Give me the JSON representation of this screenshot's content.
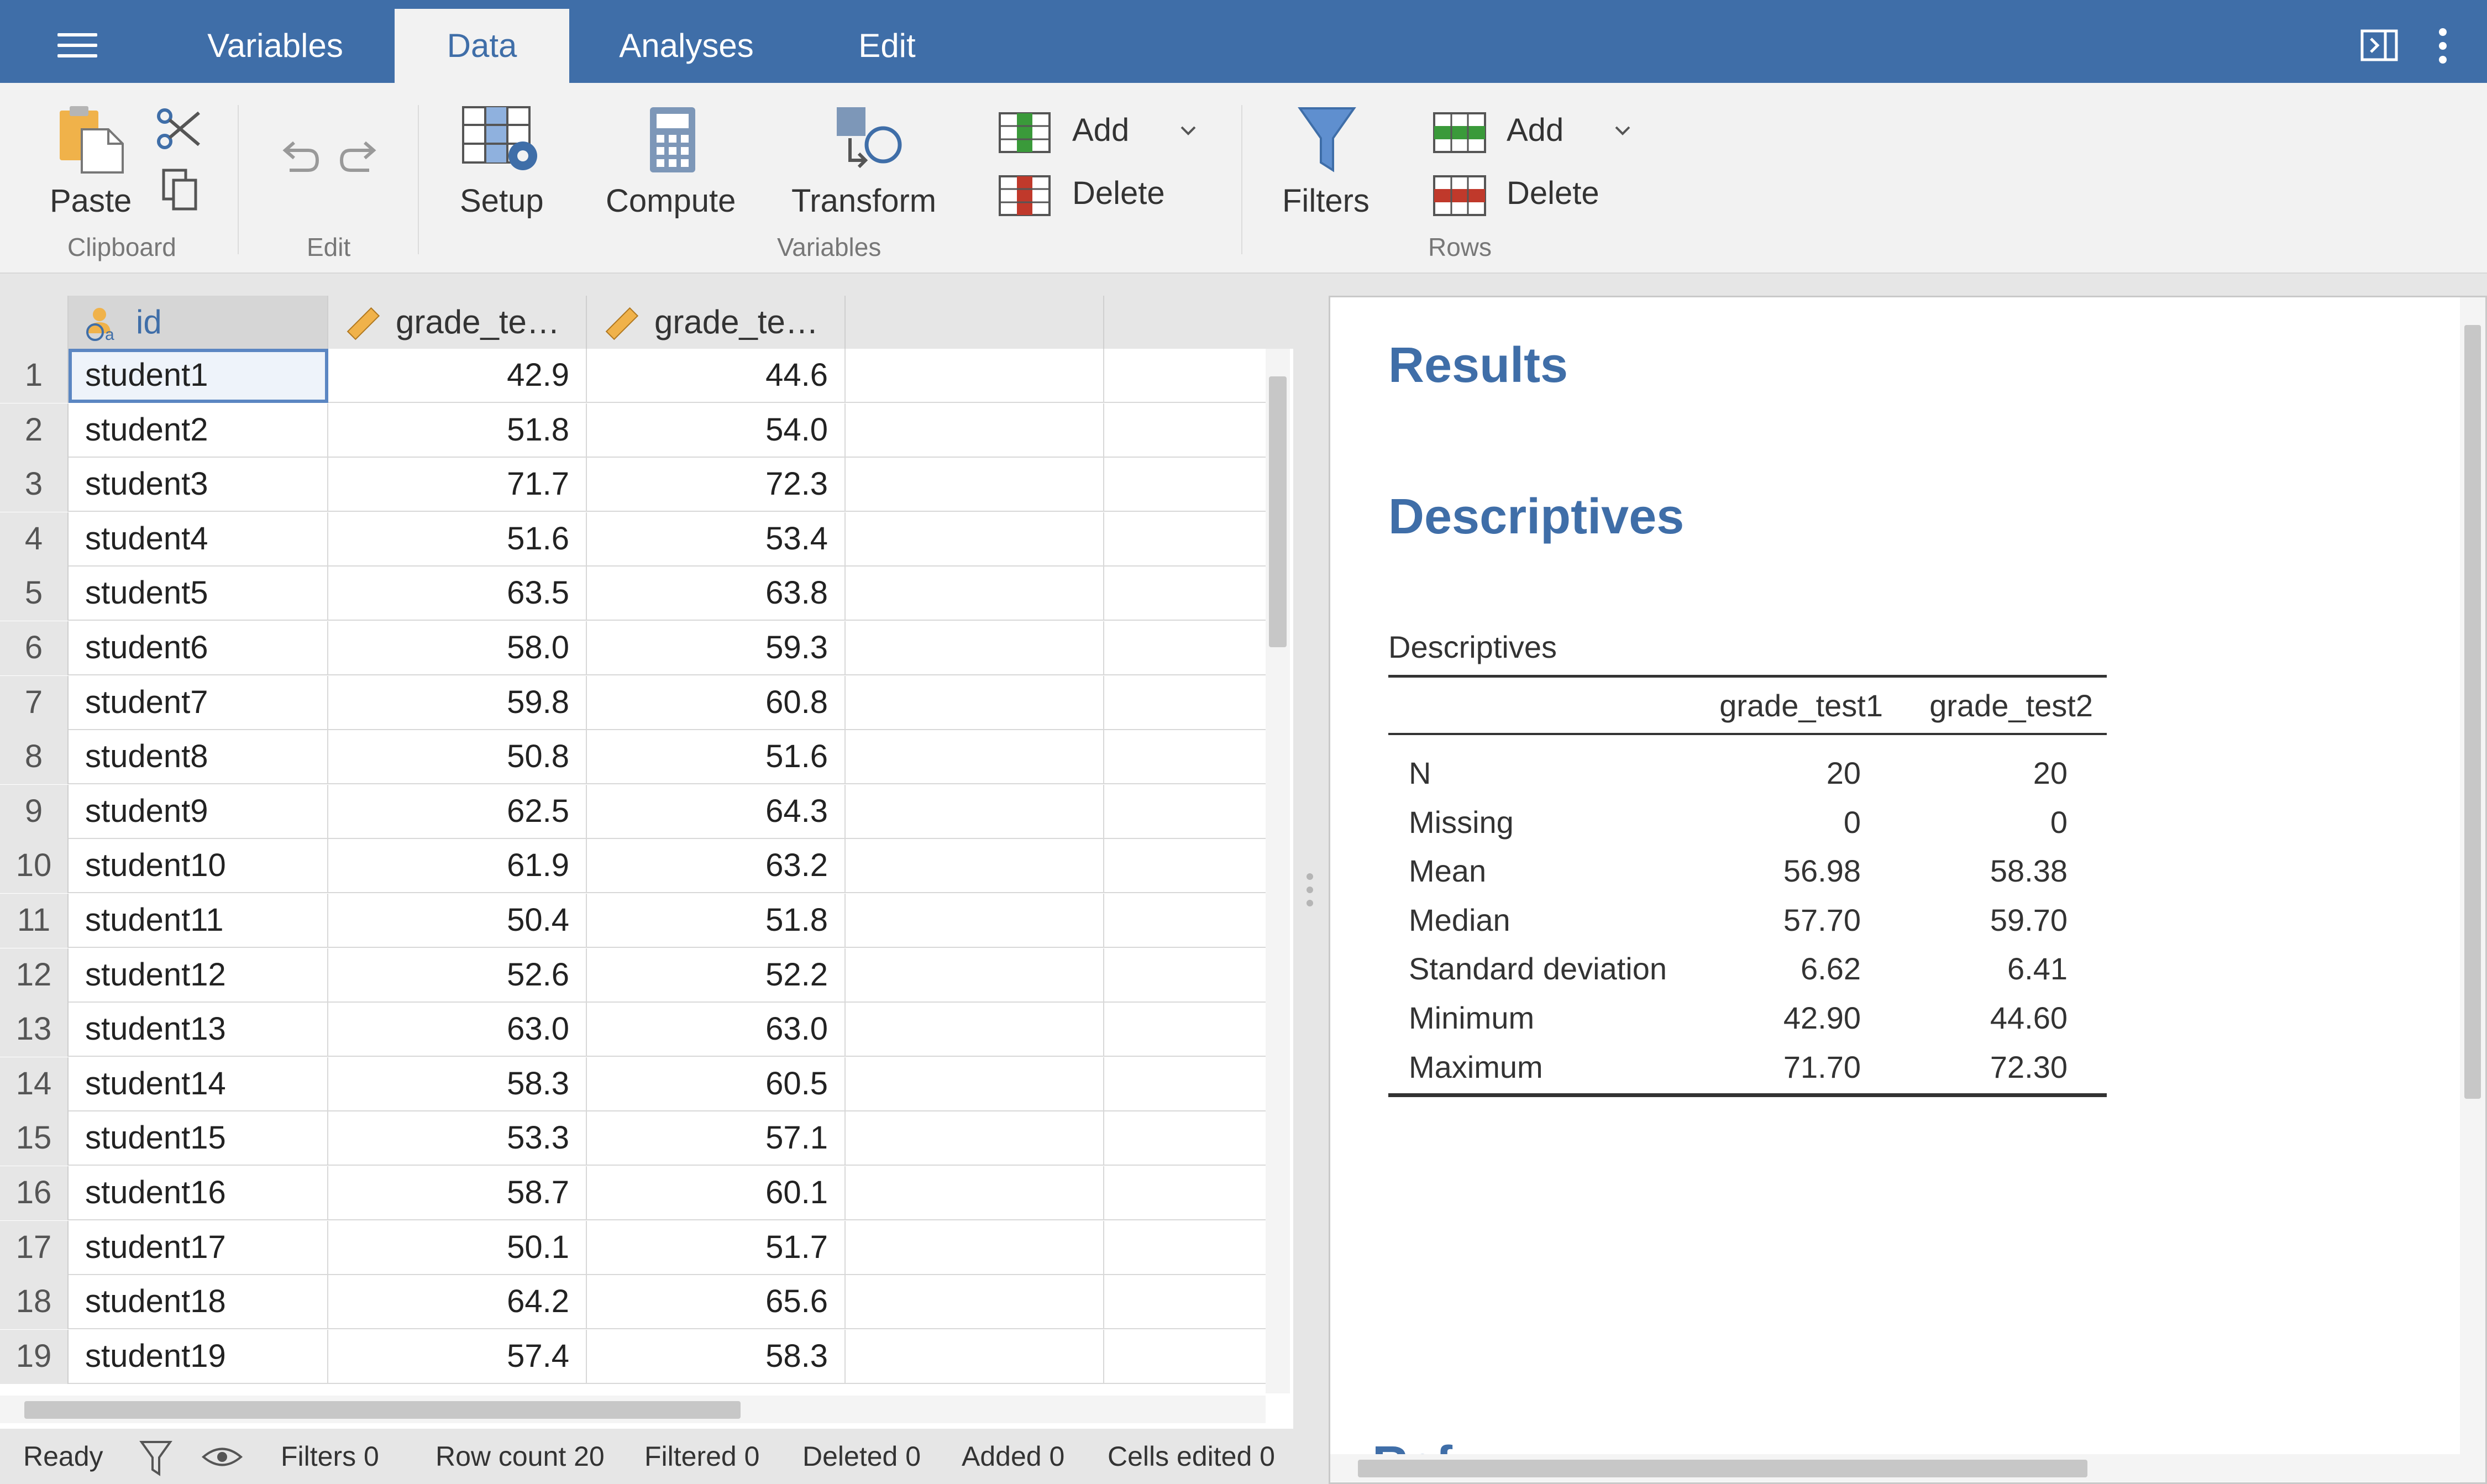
{
  "menu": {
    "tabs": [
      "Variables",
      "Data",
      "Analyses",
      "Edit"
    ],
    "active_tab": "Data"
  },
  "ribbon": {
    "paste": "Paste",
    "clipboard_group": "Clipboard",
    "edit_group": "Edit",
    "setup": "Setup",
    "compute": "Compute",
    "transform": "Transform",
    "var_add": "Add",
    "var_delete": "Delete",
    "variables_group": "Variables",
    "filters": "Filters",
    "row_add": "Add",
    "row_delete": "Delete",
    "rows_group": "Rows"
  },
  "grid": {
    "columns": [
      "id",
      "grade_te…",
      "grade_te…"
    ],
    "rows": [
      {
        "n": "1",
        "id": "student1",
        "g1": "42.9",
        "g2": "44.6"
      },
      {
        "n": "2",
        "id": "student2",
        "g1": "51.8",
        "g2": "54.0"
      },
      {
        "n": "3",
        "id": "student3",
        "g1": "71.7",
        "g2": "72.3"
      },
      {
        "n": "4",
        "id": "student4",
        "g1": "51.6",
        "g2": "53.4"
      },
      {
        "n": "5",
        "id": "student5",
        "g1": "63.5",
        "g2": "63.8"
      },
      {
        "n": "6",
        "id": "student6",
        "g1": "58.0",
        "g2": "59.3"
      },
      {
        "n": "7",
        "id": "student7",
        "g1": "59.8",
        "g2": "60.8"
      },
      {
        "n": "8",
        "id": "student8",
        "g1": "50.8",
        "g2": "51.6"
      },
      {
        "n": "9",
        "id": "student9",
        "g1": "62.5",
        "g2": "64.3"
      },
      {
        "n": "10",
        "id": "student10",
        "g1": "61.9",
        "g2": "63.2"
      },
      {
        "n": "11",
        "id": "student11",
        "g1": "50.4",
        "g2": "51.8"
      },
      {
        "n": "12",
        "id": "student12",
        "g1": "52.6",
        "g2": "52.2"
      },
      {
        "n": "13",
        "id": "student13",
        "g1": "63.0",
        "g2": "63.0"
      },
      {
        "n": "14",
        "id": "student14",
        "g1": "58.3",
        "g2": "60.5"
      },
      {
        "n": "15",
        "id": "student15",
        "g1": "53.3",
        "g2": "57.1"
      },
      {
        "n": "16",
        "id": "student16",
        "g1": "58.7",
        "g2": "60.1"
      },
      {
        "n": "17",
        "id": "student17",
        "g1": "50.1",
        "g2": "51.7"
      },
      {
        "n": "18",
        "id": "student18",
        "g1": "64.2",
        "g2": "65.6"
      },
      {
        "n": "19",
        "id": "student19",
        "g1": "57.4",
        "g2": "58.3"
      }
    ]
  },
  "status": {
    "ready": "Ready",
    "filters": "Filters 0",
    "row_count": "Row count 20",
    "filtered": "Filtered 0",
    "deleted": "Deleted 0",
    "added": "Added 0",
    "cells_edited": "Cells edited 0"
  },
  "results": {
    "heading": "Results",
    "section": "Descriptives",
    "table_title": "Descriptives",
    "col1": "grade_test1",
    "col2": "grade_test2",
    "rows": [
      {
        "label": "N",
        "v1": "20",
        "v2": "20"
      },
      {
        "label": "Missing",
        "v1": "0",
        "v2": "0"
      },
      {
        "label": "Mean",
        "v1": "56.98",
        "v2": "58.38"
      },
      {
        "label": "Median",
        "v1": "57.70",
        "v2": "59.70"
      },
      {
        "label": "Standard deviation",
        "v1": "6.62",
        "v2": "6.41"
      },
      {
        "label": "Minimum",
        "v1": "42.90",
        "v2": "44.60"
      },
      {
        "label": "Maximum",
        "v1": "71.70",
        "v2": "72.30"
      }
    ]
  },
  "icons": {
    "menu": "hamburger-icon",
    "results_mode": "split-view-icon",
    "more": "more-vertical-icon",
    "nominal": "nominal-variable-icon",
    "continuous": "ruler-icon"
  },
  "colors": {
    "brand": "#3f6ea8",
    "add_green": "#3a9a3a",
    "delete_red": "#c0392b",
    "selection": "#5b86c2"
  }
}
